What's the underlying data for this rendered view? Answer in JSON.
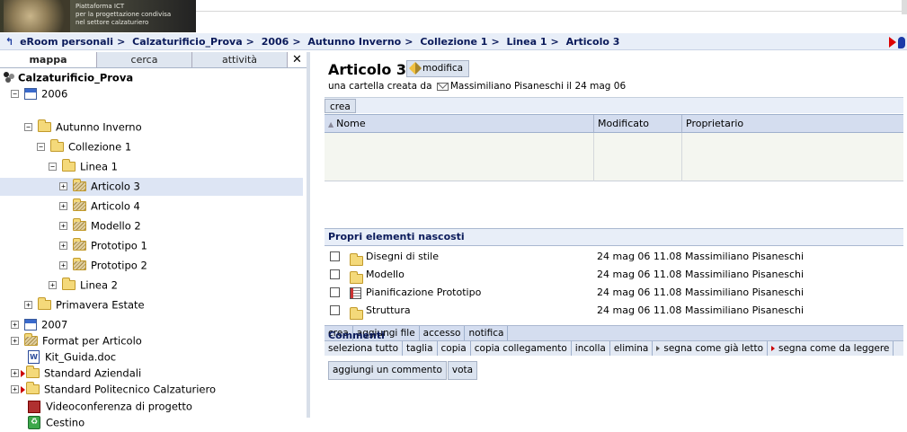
{
  "banner": {
    "line1": "Piattaforma ICT",
    "line2": "per la progettazione condivisa",
    "line3": "nel settore calzaturiero"
  },
  "breadcrumb": [
    "eRoom personali",
    "Calzaturificio_Prova",
    "2006",
    "Autunno Inverno",
    "Collezione 1",
    "Linea 1",
    "Articolo 3"
  ],
  "tabs": {
    "map": "mappa",
    "search": "cerca",
    "activity": "attività",
    "close": "✕"
  },
  "tree": {
    "root": "Calzaturificio_Prova",
    "items": [
      {
        "label": "2006"
      },
      {
        "label": "Autunno Inverno"
      },
      {
        "label": "Collezione 1"
      },
      {
        "label": "Linea 1"
      },
      {
        "label": "Articolo 3"
      },
      {
        "label": "Articolo 4"
      },
      {
        "label": "Modello 2"
      },
      {
        "label": "Prototipo 1"
      },
      {
        "label": "Prototipo 2"
      },
      {
        "label": "Linea 2"
      },
      {
        "label": "Primavera Estate"
      },
      {
        "label": "2007"
      },
      {
        "label": "Format per Articolo"
      },
      {
        "label": "Kit_Guida.doc"
      },
      {
        "label": "Standard Aziendali"
      },
      {
        "label": "Standard Politecnico Calzaturiero"
      },
      {
        "label": "Videoconferenza di progetto"
      },
      {
        "label": "Cestino"
      }
    ]
  },
  "page": {
    "title": "Articolo 3",
    "edit_label": "modifica",
    "subtitle_prefix": "una cartella creata da",
    "creator": "Massimiliano Pisaneschi",
    "created": "il 24 mag 06"
  },
  "table": {
    "crea": "crea",
    "columns": {
      "name": "Nome",
      "modified": "Modificato",
      "owner": "Proprietario"
    },
    "hidden_header": "Propri elementi nascosti",
    "rows": [
      {
        "name": "Disegni di stile",
        "modified": "24 mag 06  11.08",
        "owner": "Massimiliano Pisaneschi"
      },
      {
        "name": "Modello",
        "modified": "24 mag 06  11.08",
        "owner": "Massimiliano Pisaneschi"
      },
      {
        "name": "Pianificazione Prototipo",
        "modified": "24 mag 06  11.08",
        "owner": "Massimiliano Pisaneschi"
      },
      {
        "name": "Struttura",
        "modified": "24 mag 06  11.08",
        "owner": "Massimiliano Pisaneschi"
      }
    ]
  },
  "toolbar1": [
    "crea",
    "aggiungi file",
    "accesso",
    "notifica"
  ],
  "toolbar2": [
    "seleziona tutto",
    "taglia",
    "copia",
    "copia collegamento",
    "incolla",
    "elimina",
    "segna come già letto",
    "segna come da leggere"
  ],
  "comments": {
    "title": "Commenti",
    "add": "aggiungi un commento",
    "vote": "vota"
  }
}
